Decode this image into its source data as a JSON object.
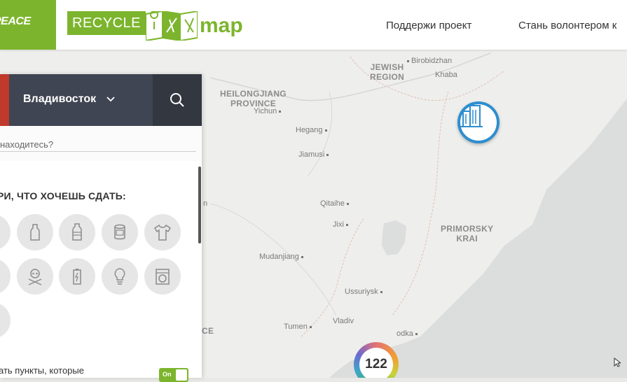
{
  "header": {
    "gp_logo_text": "PEACE",
    "recycle_text": "RECYCLE",
    "map_text": "map",
    "nav": [
      "Поддержи проект",
      "Стань волонтером к"
    ]
  },
  "panel": {
    "city": "Владивосток",
    "location_placeholder": "находитесь?",
    "section_title": "РИ, ЧТО ХОЧЕШЬ СДАТЬ:",
    "bottom_text": "ать пункты, которые",
    "toggle_label": "On"
  },
  "map": {
    "regions": [
      {
        "id": "jewish",
        "line1": "JEWISH",
        "line2": "REGION"
      },
      {
        "id": "heilong",
        "line1": "HEILONGJIANG",
        "line2": "PROVINCE"
      },
      {
        "id": "primorsky",
        "line1": "PRIMORSKY",
        "line2": "KRAI"
      }
    ],
    "cities": {
      "birobidzhan": "Birobidzhan",
      "khaba": "Khaba",
      "yichun": "Yichun",
      "hegang": "Hegang",
      "jiamusi": "Jiamusi",
      "qitaihe": "Qitaihe",
      "jixi": "Jixi",
      "mudanjiang": "Mudanjiang",
      "ussuriysk": "Ussuriysk",
      "vladiv": "Vladiv",
      "nakhodka": "odka",
      "tumen": "Tumen",
      "ce": "CE",
      "n_edge": "n"
    },
    "cluster_count": "122"
  }
}
